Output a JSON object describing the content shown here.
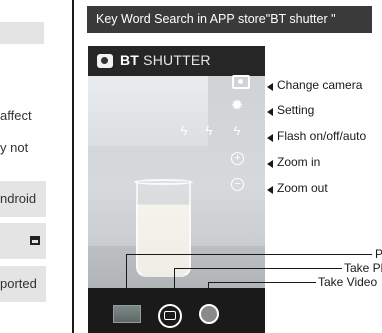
{
  "left_column": {
    "lines": [
      "affect",
      "y not",
      "ndroid",
      "ported"
    ]
  },
  "header": {
    "text": "Key Word Search in APP store\"BT shutter \""
  },
  "phone": {
    "app_name_bold": "BT",
    "app_name_rest": "SHUTTER",
    "icons": {
      "camera_switch": "camera-switch-icon",
      "settings": "gear-icon",
      "flash": "flash-icon",
      "zoom_in": "zoom-in-icon",
      "zoom_out": "zoom-out-icon",
      "shutter": "camera-shutter-icon",
      "video": "video-record-icon"
    }
  },
  "annotations": {
    "change_camera": "Change camera",
    "setting": "Setting",
    "flash": "Flash on/off/auto",
    "zoom_in": "Zoom in",
    "zoom_out": "Zoom out",
    "preview": "P",
    "take_photo": "Take Pl",
    "take_video": "Take Video"
  },
  "colors": {
    "header_bg": "#3a3a3a",
    "phone_bg": "#1e1e1e",
    "text": "#1a1a1a"
  }
}
